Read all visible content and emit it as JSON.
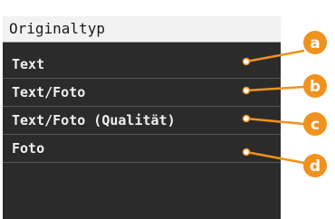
{
  "panel": {
    "title": "Originaltyp",
    "items": [
      {
        "label": "Text",
        "callout": "a"
      },
      {
        "label": "Text/Foto",
        "callout": "b"
      },
      {
        "label": "Text/Foto (Qualität)",
        "callout": "c"
      },
      {
        "label": "Foto",
        "callout": "d"
      }
    ]
  },
  "colors": {
    "callout": "#f0921e",
    "panel_bg": "#2b2b2b",
    "title_bg": "#f2f2f2"
  }
}
